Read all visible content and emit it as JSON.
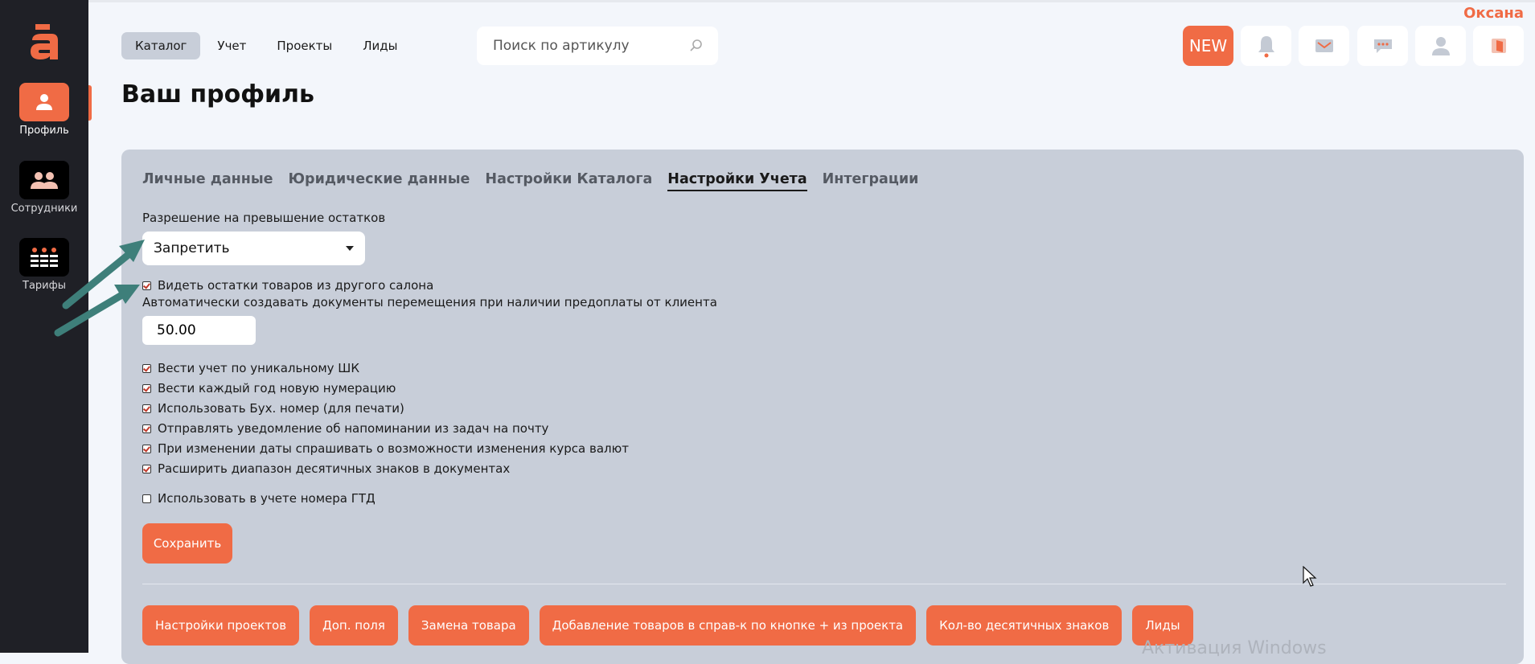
{
  "user": {
    "name": "Оксана"
  },
  "sidebar": {
    "items": [
      {
        "label": "Профиль",
        "icon": "user-icon",
        "active": true
      },
      {
        "label": "Сотрудники",
        "icon": "users-icon",
        "active": false
      },
      {
        "label": "Тарифы",
        "icon": "grid-icon",
        "active": false
      }
    ]
  },
  "nav": {
    "items": [
      {
        "label": "Каталог",
        "active": true
      },
      {
        "label": "Учет",
        "active": false
      },
      {
        "label": "Проекты",
        "active": false
      },
      {
        "label": "Лиды",
        "active": false
      }
    ]
  },
  "search": {
    "placeholder": "Поиск по артикулу"
  },
  "top_actions": {
    "new_label": "NEW"
  },
  "page": {
    "title": "Ваш профиль"
  },
  "tabs": [
    {
      "label": "Личные данные",
      "active": false
    },
    {
      "label": "Юридические данные",
      "active": false
    },
    {
      "label": "Настройки Каталога",
      "active": false
    },
    {
      "label": "Настройки Учета",
      "active": true
    },
    {
      "label": "Интеграции",
      "active": false
    }
  ],
  "form": {
    "overstock_label": "Разрешение на превышение остатков",
    "overstock_value": "Запретить",
    "see_other_salon": {
      "label": "Видеть остатки товаров из другого салона",
      "checked": true
    },
    "auto_docs_label": "Автоматически создавать документы перемещения при наличии предоплаты от клиента",
    "auto_docs_value": "50.00",
    "checkboxes": [
      {
        "label": "Вести учет по уникальному ШК",
        "checked": true
      },
      {
        "label": "Вести каждый год новую нумерацию",
        "checked": true
      },
      {
        "label": "Использовать Бух. номер (для печати)",
        "checked": true
      },
      {
        "label": "Отправлять уведомление об напоминании из задач на почту",
        "checked": true
      },
      {
        "label": "При изменении даты спрашивать о возможности изменения курса валют",
        "checked": true
      },
      {
        "label": "Расширить диапазон десятичных знаков в документах",
        "checked": true
      }
    ],
    "gtd": {
      "label": "Использовать в учете номера ГТД",
      "checked": false
    },
    "save_label": "Сохранить"
  },
  "bottom_buttons": [
    "Настройки проектов",
    "Доп. поля",
    "Замена товара",
    "Добавление товаров в справ-к по кнопке + из проекта",
    "Кол-во десятичных знаков",
    "Лиды"
  ],
  "watermark": "Активация Windows",
  "colors": {
    "accent": "#f06b45",
    "sidebar": "#1f2026",
    "panel": "#c8ced9",
    "arrow": "#3e7f7a"
  }
}
